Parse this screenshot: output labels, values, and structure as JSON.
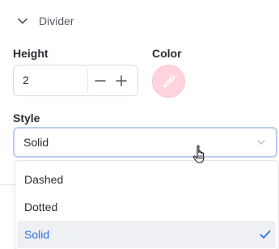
{
  "section": {
    "title": "Divider",
    "chevron_icon": "chevron-down-icon"
  },
  "height": {
    "label": "Height",
    "value": "2",
    "decrement_icon": "minus-icon",
    "increment_icon": "plus-icon"
  },
  "color": {
    "label": "Color",
    "value": "#ffd4dc",
    "icon": "eyedropper-icon"
  },
  "style": {
    "label": "Style",
    "selected": "Solid",
    "options": [
      {
        "label": "Dashed",
        "selected": false
      },
      {
        "label": "Dotted",
        "selected": false
      },
      {
        "label": "Solid",
        "selected": true
      }
    ],
    "check_icon": "check-icon",
    "accent_color": "#2f6fe4"
  }
}
